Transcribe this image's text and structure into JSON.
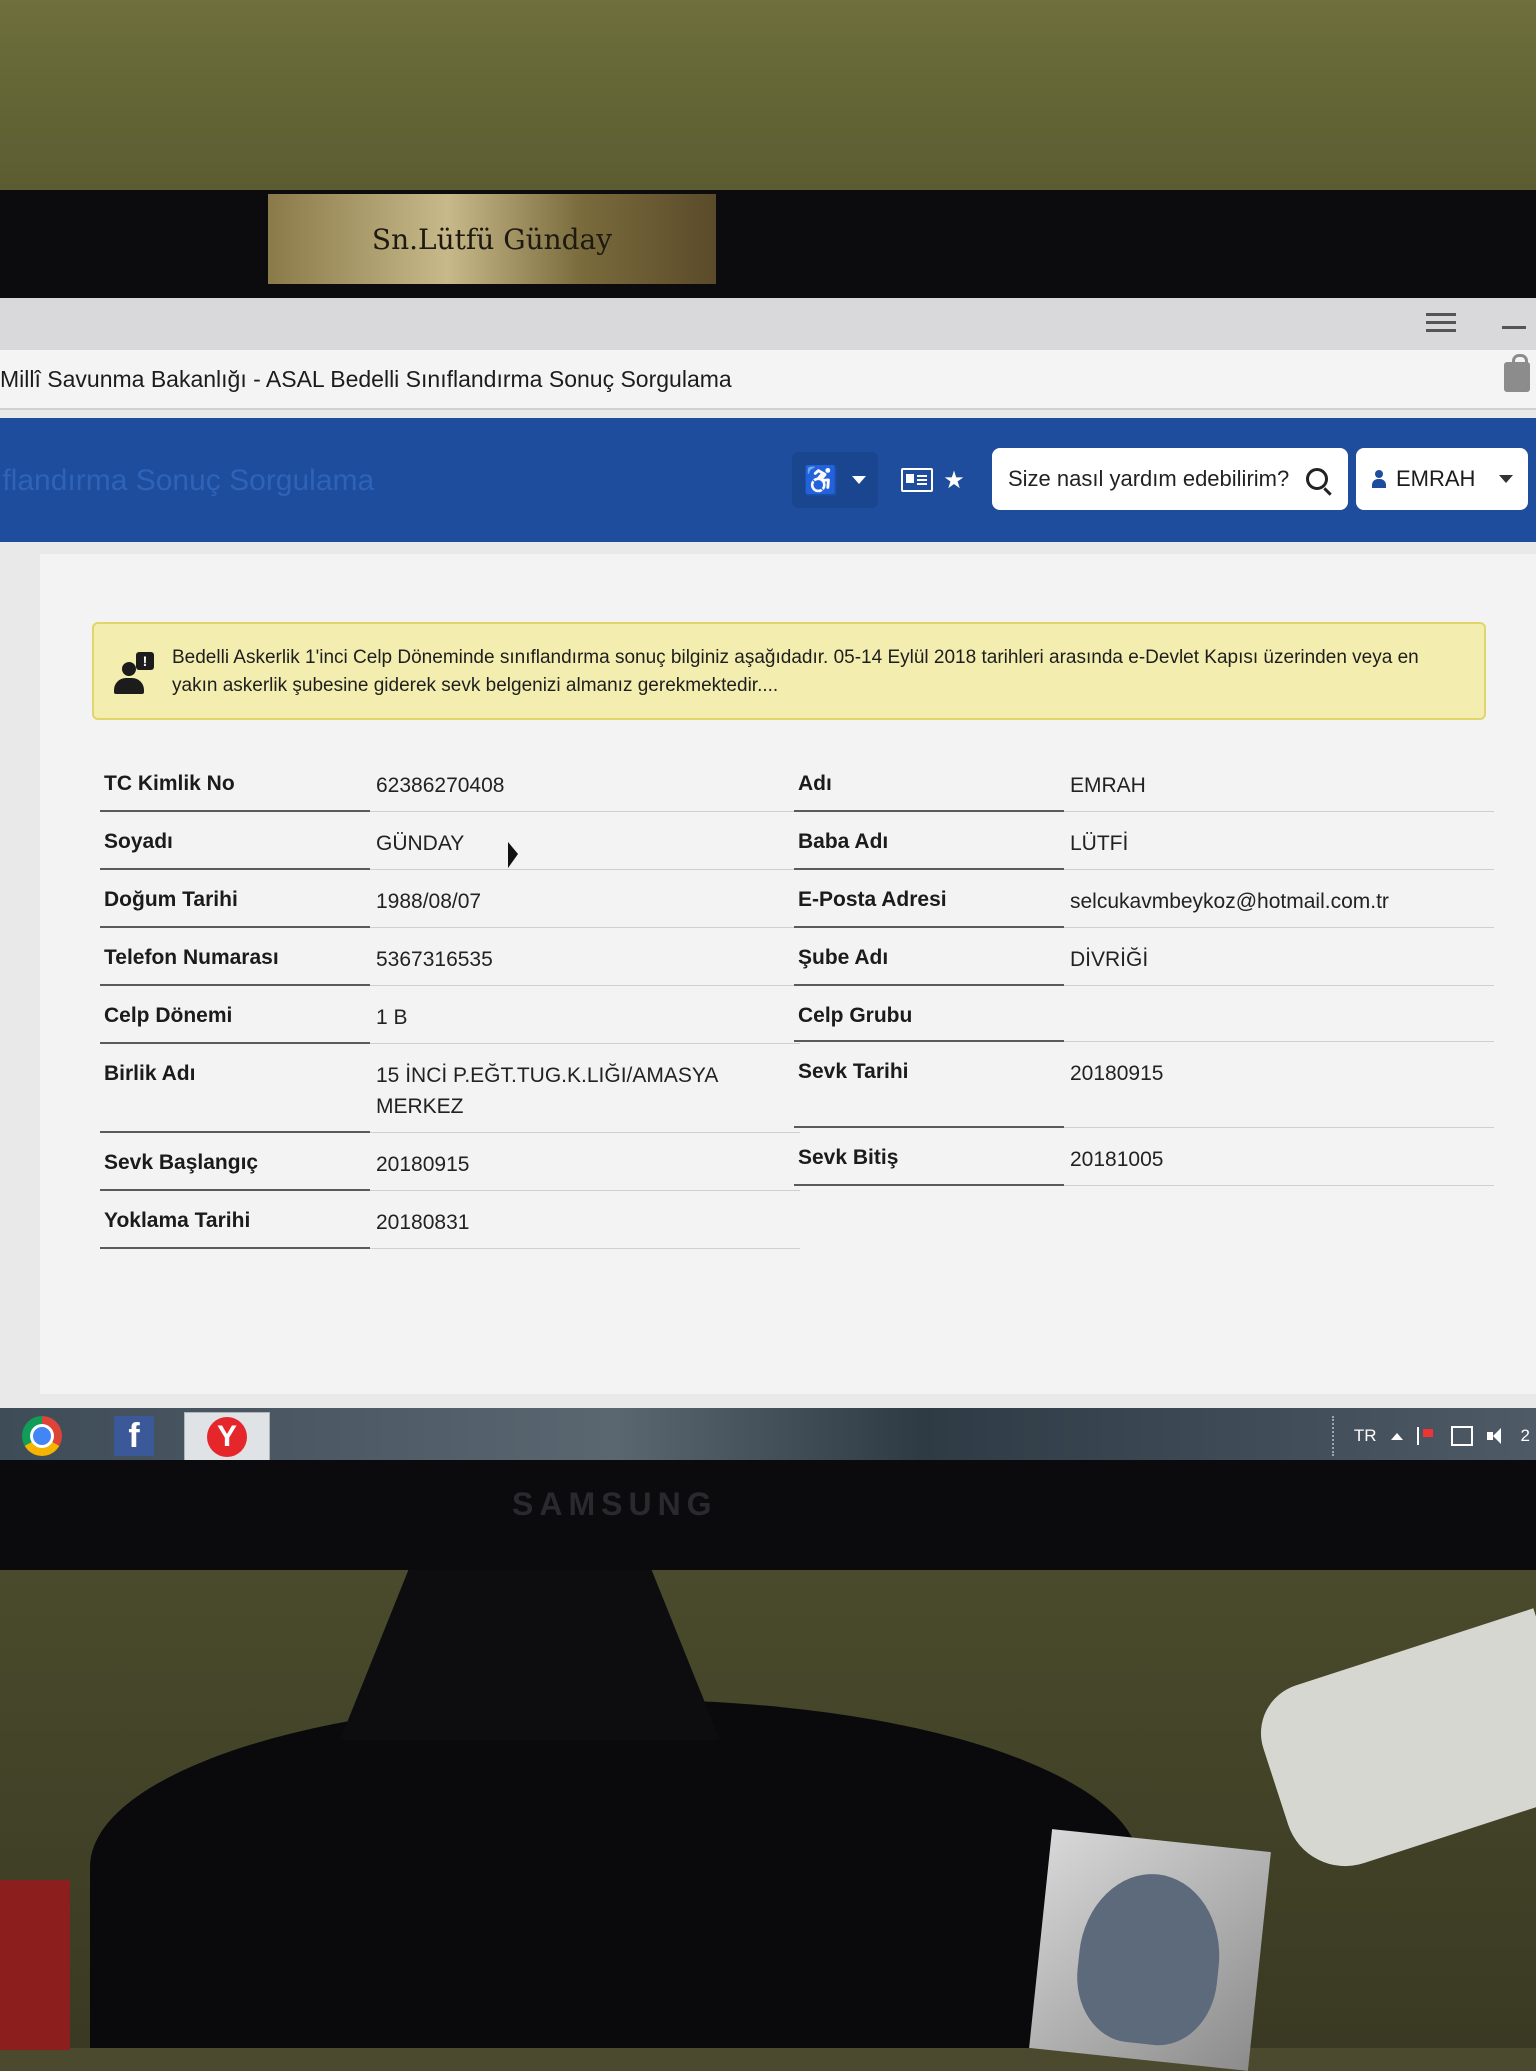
{
  "desktop": {
    "wallpaper_caption": "Sn.Lütfü Günday"
  },
  "browser": {
    "tab_title": "Millî Savunma Bakanlığı - ASAL Bedelli Sınıflandırma Sonuç Sorgulama"
  },
  "header": {
    "faded_title": "ıflandırma Sonuç Sorgulama",
    "search_placeholder": "Size nasıl yardım edebilirim?",
    "user_name": "EMRAH",
    "accessibility_icon": "wheelchair-icon",
    "card_icon": "id-card-icon",
    "favorite_icon": "star-icon",
    "search_icon": "magnifier-icon"
  },
  "alert": {
    "text": "Bedelli Askerlik 1'inci Celp Döneminde sınıflandırma sonuç bilginiz aşağıdadır. 05-14 Eylül 2018 tarihleri arasında e-Devlet Kapısı üzerinden veya en yakın askerlik şubesine giderek sevk belgenizi almanız gerekmektedir...."
  },
  "info_left": [
    {
      "label": "TC Kimlik No",
      "value": "62386270408"
    },
    {
      "label": "Soyadı",
      "value": "GÜNDAY"
    },
    {
      "label": "Doğum Tarihi",
      "value": "1988/08/07"
    },
    {
      "label": "Telefon Numarası",
      "value": "5367316535"
    },
    {
      "label": "Celp Dönemi",
      "value": "1 B"
    },
    {
      "label": "Birlik Adı",
      "value": "15 İNCİ P.EĞT.TUG.K.LIĞI/AMASYA MERKEZ"
    },
    {
      "label": "Sevk Başlangıç",
      "value": "20180915"
    },
    {
      "label": "Yoklama Tarihi",
      "value": "20180831"
    }
  ],
  "info_right": [
    {
      "label": "Adı",
      "value": "EMRAH"
    },
    {
      "label": "Baba Adı",
      "value": "LÜTFİ"
    },
    {
      "label": "E-Posta Adresi",
      "value": "selcukavmbeykoz@hotmail.com.tr"
    },
    {
      "label": "Şube Adı",
      "value": "DİVRİĞİ"
    },
    {
      "label": "Celp Grubu",
      "value": ""
    },
    {
      "label": "Sevk Tarihi",
      "value": "20180915"
    },
    {
      "label": "Sevk Bitiş",
      "value": "20181005"
    }
  ],
  "taskbar": {
    "language": "TR",
    "clock_fragment": "2",
    "apps": [
      "chrome-icon",
      "facebook-icon",
      "yandex-browser-icon"
    ]
  },
  "monitor": {
    "brand": "SAMSUNG"
  }
}
